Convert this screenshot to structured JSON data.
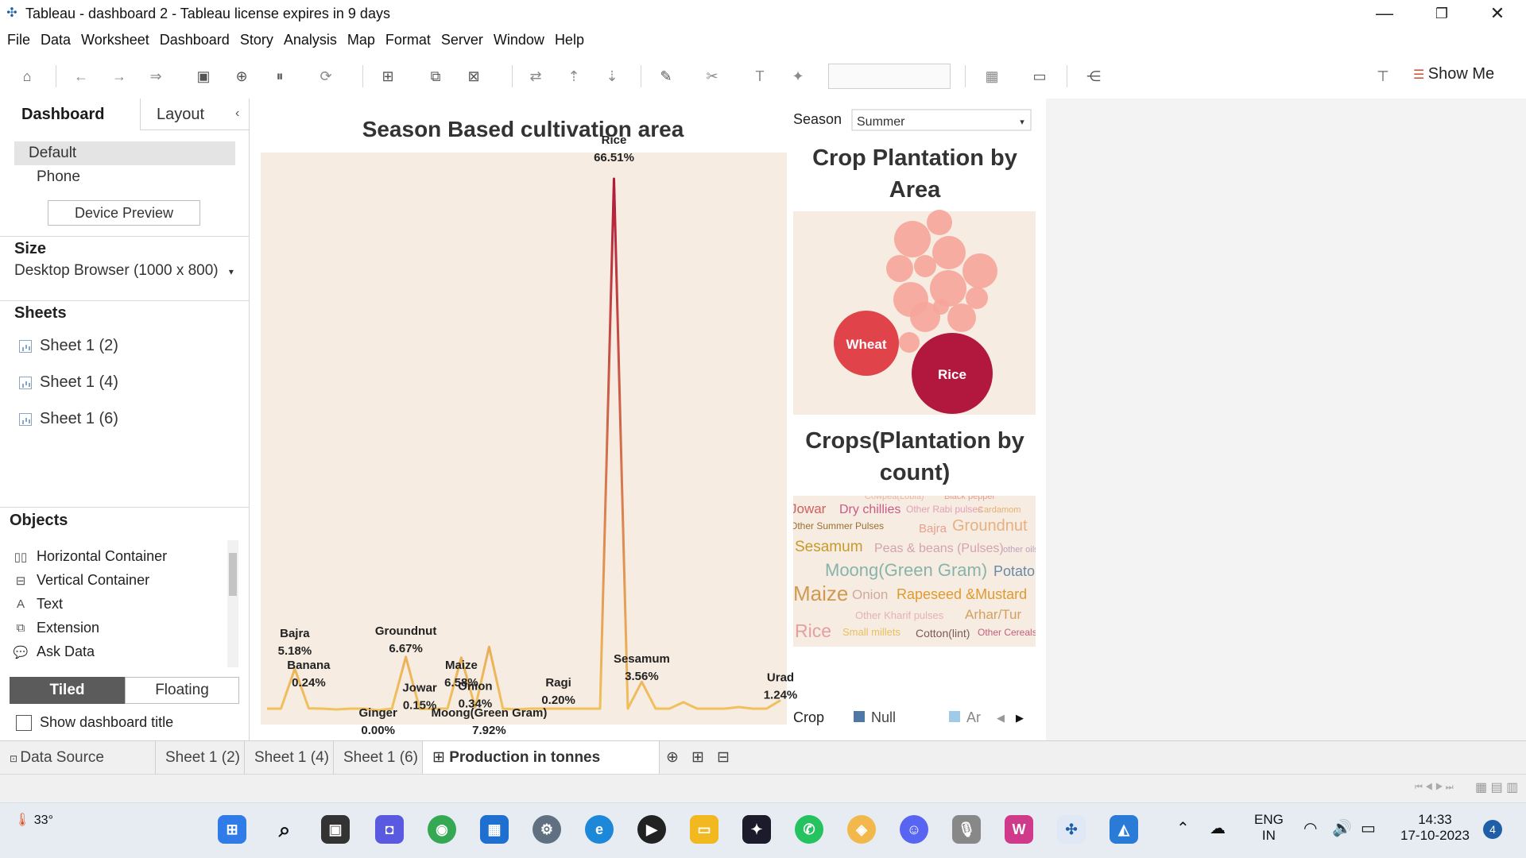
{
  "window": {
    "title": "Tableau - dashboard 2 - Tableau license expires in 9 days"
  },
  "menu": [
    "File",
    "Data",
    "Worksheet",
    "Dashboard",
    "Story",
    "Analysis",
    "Map",
    "Format",
    "Server",
    "Window",
    "Help"
  ],
  "toolbar": {
    "show_me": "Show Me"
  },
  "left_pane": {
    "tab_dashboard": "Dashboard",
    "tab_layout": "Layout",
    "devices": [
      "Default",
      "Phone"
    ],
    "device_preview": "Device Preview",
    "size_header": "Size",
    "size_value": "Desktop Browser (1000 x 800)",
    "sheets_header": "Sheets",
    "sheets": [
      "Sheet 1 (2)",
      "Sheet 1 (4)",
      "Sheet 1 (6)"
    ],
    "objects_header": "Objects",
    "objects": [
      {
        "label": "Horizontal Container",
        "icon": "horizontal-container-icon",
        "glyph": "▯▯"
      },
      {
        "label": "Vertical Container",
        "icon": "vertical-container-icon",
        "glyph": "⊟"
      },
      {
        "label": "Text",
        "icon": "text-icon",
        "glyph": "A"
      },
      {
        "label": "Extension",
        "icon": "extension-icon",
        "glyph": "⧉"
      },
      {
        "label": "Ask Data",
        "icon": "ask-data-icon",
        "glyph": "💬"
      }
    ],
    "tiled": "Tiled",
    "floating": "Floating",
    "show_title": "Show dashboard title"
  },
  "dashboard": {
    "line_title": "Season Based cultivation area",
    "filter_label": "Season",
    "filter_value": "Summer",
    "bubble_title": "Crop Plantation by Area",
    "word_title": "Crops(Plantation by count)",
    "legend_label": "Crop",
    "legend_items": [
      "Null",
      "Ar"
    ],
    "bubble_labels": [
      "Wheat",
      "Rice"
    ],
    "words": [
      {
        "t": "Cowpea(Lobia)",
        "c": "#e8b8a8"
      },
      {
        "t": "Black pepper",
        "c": "#e4a090"
      },
      {
        "t": "Jowar",
        "c": "#d06060"
      },
      {
        "t": "Dry chillies",
        "c": "#c85a8a"
      },
      {
        "t": "Other Rabi pulses",
        "c": "#e2a0b8"
      },
      {
        "t": "Cardamom",
        "c": "#e7b070"
      },
      {
        "t": "Other Summer Pulses",
        "c": "#9a7030"
      },
      {
        "t": "Bajra",
        "c": "#e8a090"
      },
      {
        "t": "Groundnut",
        "c": "#e6b080"
      },
      {
        "t": "Sesamum",
        "c": "#c79a2a"
      },
      {
        "t": "Peas & beans (Pulses)",
        "c": "#d4a2b2"
      },
      {
        "t": "other oilseed",
        "c": "#c0a0c0"
      },
      {
        "t": "Moong(Green Gram)",
        "c": "#86b4ac"
      },
      {
        "t": "Potato",
        "c": "#6a8aa8"
      },
      {
        "t": "Maize",
        "c": "#cf9a50"
      },
      {
        "t": "Onion",
        "c": "#d0a8a0"
      },
      {
        "t": "Rapeseed &Mustard",
        "c": "#e09a30"
      },
      {
        "t": "Other Kharif pulses",
        "c": "#e6b2b2"
      },
      {
        "t": "Arhar/Tur",
        "c": "#d4a060"
      },
      {
        "t": "Rice",
        "c": "#e2a0a0"
      },
      {
        "t": "Small millets",
        "c": "#e8c060"
      },
      {
        "t": "Cotton(lint)",
        "c": "#7a5a5a"
      },
      {
        "t": "Other Cereals",
        "c": "#c06080"
      }
    ]
  },
  "chart_data": {
    "type": "line",
    "title": "Season Based cultivation area",
    "categories": [
      "Bajra",
      "Banana",
      "Ginger",
      "Groundnut",
      "Jowar",
      "Maize",
      "Onion",
      "Moong(Green Gram)",
      "Ragi",
      "Rice",
      "Sesamum",
      "Urad"
    ],
    "series": [
      {
        "values": [
          5.18,
          0.24,
          0.0,
          6.67,
          0.15,
          6.58,
          0.34,
          7.92,
          0.2,
          66.51,
          3.56,
          1.24
        ]
      }
    ],
    "data_labels": [
      "5.18%",
      "0.24%",
      "0.00%",
      "6.67%",
      "0.15%",
      "6.58%",
      "0.34%",
      "7.92%",
      "0.20%",
      "66.51%",
      "3.56%",
      "1.24%"
    ],
    "ylim": [
      0,
      70
    ],
    "grid": false,
    "legend": "none"
  },
  "tabs": {
    "data_source": "Data Source",
    "sheets": [
      "Sheet 1 (2)",
      "Sheet 1 (4)",
      "Sheet 1 (6)"
    ],
    "active": "Production in tonnes region-..."
  },
  "taskbar": {
    "temperature": "33°",
    "language": "ENG",
    "region": "IN",
    "time": "14:33",
    "date": "17-10-2023",
    "notifications": "4"
  },
  "colors": {
    "chart_bg": "#f6ece1",
    "line_low": "#f1c15d",
    "line_high": "#b2193a",
    "bubble_small": "#f6a59a",
    "bubble_wheat": "#e0434a",
    "bubble_rice": "#b2183d"
  }
}
